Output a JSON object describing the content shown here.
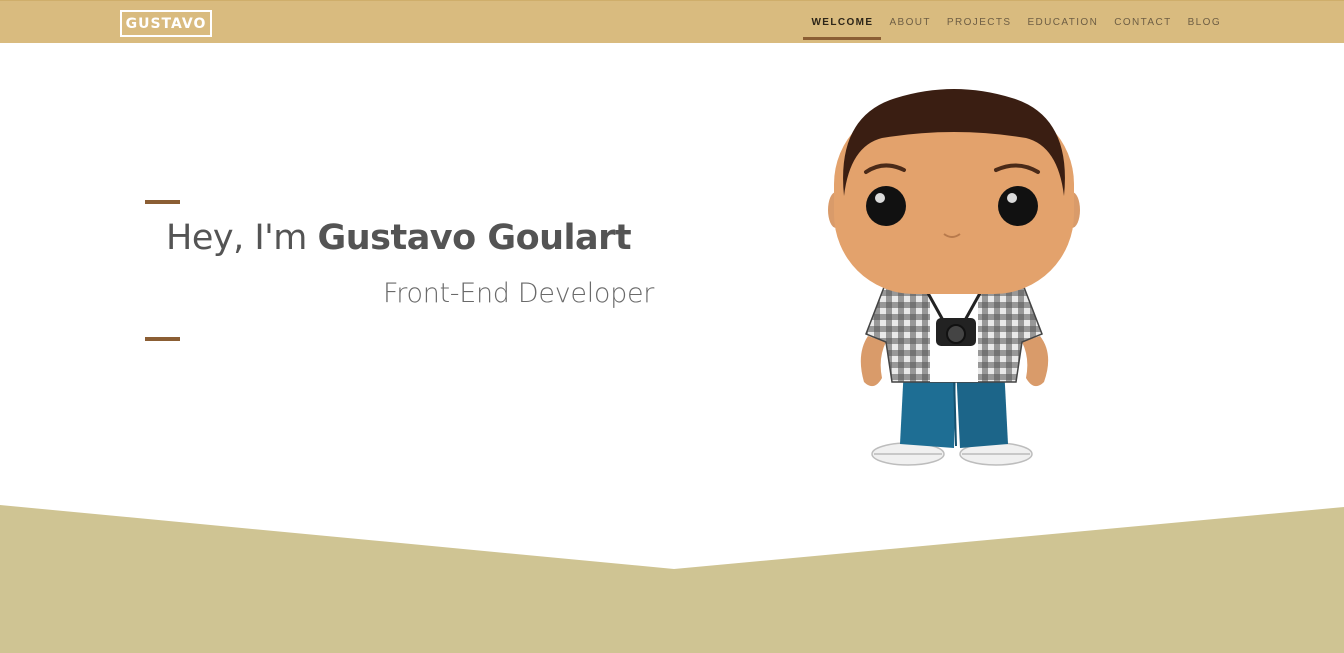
{
  "brand": {
    "label": "GUSTAVO"
  },
  "nav": {
    "items": [
      {
        "label": "WELCOME",
        "active": true
      },
      {
        "label": "ABOUT",
        "active": false
      },
      {
        "label": "PROJECTS",
        "active": false
      },
      {
        "label": "EDUCATION",
        "active": false
      },
      {
        "label": "CONTACT",
        "active": false
      },
      {
        "label": "BLOG",
        "active": false
      }
    ]
  },
  "hero": {
    "greeting": "Hey, I'm ",
    "name": "Gustavo Goulart",
    "subtitle": "Front-End Developer"
  },
  "colors": {
    "navbar": "#d9bb7f",
    "accent": "#8b5e34",
    "footer": "#cfc493",
    "text": "#545454"
  }
}
